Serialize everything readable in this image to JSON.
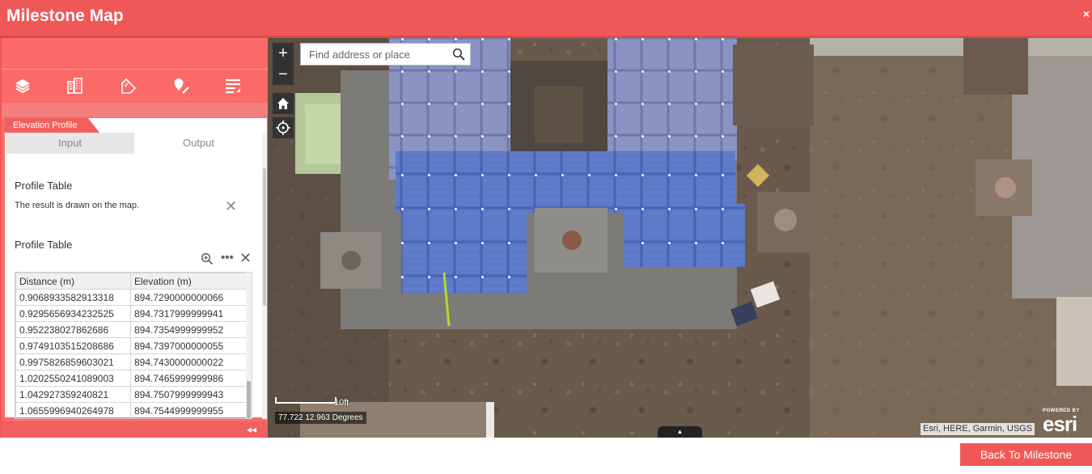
{
  "app": {
    "title": "Milestone Map",
    "close_label": "×"
  },
  "toolbar": {
    "items": [
      {
        "icon": "layers-icon"
      },
      {
        "icon": "buildings-icon"
      },
      {
        "icon": "measure-icon"
      },
      {
        "icon": "pin-edit-icon"
      },
      {
        "icon": "menu-list-icon"
      }
    ]
  },
  "panel": {
    "tab_label": "Elevation Profile",
    "tabs": [
      {
        "label": "Input",
        "active": false
      },
      {
        "label": "Output",
        "active": true
      }
    ],
    "section1": {
      "title": "Profile Table",
      "message": "The result is drawn on the map."
    },
    "section2": {
      "title": "Profile Table"
    },
    "table": {
      "columns": [
        "Distance (m)",
        "Elevation (m)"
      ],
      "rows": [
        [
          "0.9068933582913318",
          "894.7290000000066"
        ],
        [
          "0.9295656934232525",
          "894.7317999999941"
        ],
        [
          "0.952238027862686",
          "894.7354999999952"
        ],
        [
          "0.9749103515208686",
          "894.7397000000055"
        ],
        [
          "0.9975826859603021",
          "894.7430000000022"
        ],
        [
          "1.0202550241089003",
          "894.7465999999986"
        ],
        [
          "1.042927359240821",
          "894.7507999999943"
        ],
        [
          "1.0655996940264978",
          "894.7544999999955"
        ]
      ]
    },
    "collapse_label": "◂◂"
  },
  "map": {
    "search": {
      "placeholder": "Find address or place"
    },
    "zoom_in": "+",
    "zoom_out": "−",
    "scale_label": "10ft",
    "coordinates": "77.722 12.963 Degrees",
    "attribution": "Esri, HERE, Garmin, USGS",
    "logo": {
      "powered": "POWERED BY",
      "name": "esri"
    },
    "bottom_toggle": "▲"
  },
  "actions": {
    "back_label": "Back To Milestone"
  },
  "colors": {
    "accent": "#ef5856",
    "sidebar": "#fb6b68",
    "map_base": "#5b4d42"
  }
}
